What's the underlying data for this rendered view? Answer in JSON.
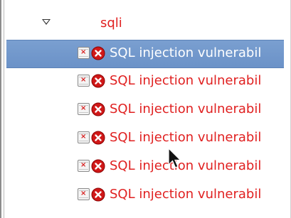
{
  "tree": {
    "group": {
      "label": "sqli",
      "expanded": true
    },
    "items": [
      {
        "label": "SQL injection vulnerabil",
        "selected": true
      },
      {
        "label": "SQL injection vulnerabil",
        "selected": false
      },
      {
        "label": "SQL injection vulnerabil",
        "selected": false
      },
      {
        "label": "SQL injection vulnerabil",
        "selected": false
      },
      {
        "label": "SQL injection vulnerabil",
        "selected": false
      },
      {
        "label": "SQL injection vulnerabil",
        "selected": false
      }
    ]
  },
  "icons": {
    "expander": "triangle-down-icon",
    "file": "document-icon",
    "error": "error-circle-icon",
    "cursor": "mouse-pointer-icon"
  },
  "colors": {
    "text_red": "#e02020",
    "selection": "#6b92c8",
    "selected_text": "#ffffff"
  }
}
